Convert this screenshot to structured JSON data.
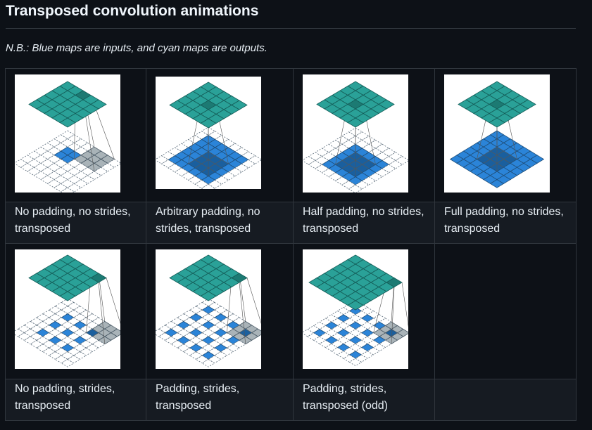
{
  "heading": "Transposed convolution animations",
  "note": "N.B.: Blue maps are inputs, and cyan maps are outputs.",
  "cells": [
    {
      "caption": "No padding, no strides, transposed",
      "figure": "no-padding-no-strides-transposed"
    },
    {
      "caption": "Arbitrary padding, no strides, transposed",
      "figure": "arbitrary-padding-no-strides-transposed"
    },
    {
      "caption": "Half padding, no strides, transposed",
      "figure": "half-padding-no-strides-transposed"
    },
    {
      "caption": "Full padding, no strides, transposed",
      "figure": "full-padding-no-strides-transposed"
    },
    {
      "caption": "No padding, strides, transposed",
      "figure": "no-padding-strides-transposed"
    },
    {
      "caption": "Padding, strides, transposed",
      "figure": "padding-strides-transposed"
    },
    {
      "caption": "Padding, strides, transposed (odd)",
      "figure": "padding-strides-odd-transposed"
    },
    {
      "caption": "",
      "figure": ""
    }
  ],
  "colors": {
    "background": "#0d1117",
    "caption_background": "#161b22",
    "border": "#30363d",
    "output_teal": "#2aa198",
    "output_teal_dark": "#1c7a73",
    "input_blue": "#2b84d8",
    "input_blue_dark": "#1a5f9e",
    "kernel_gray": "#a9b3b8"
  }
}
